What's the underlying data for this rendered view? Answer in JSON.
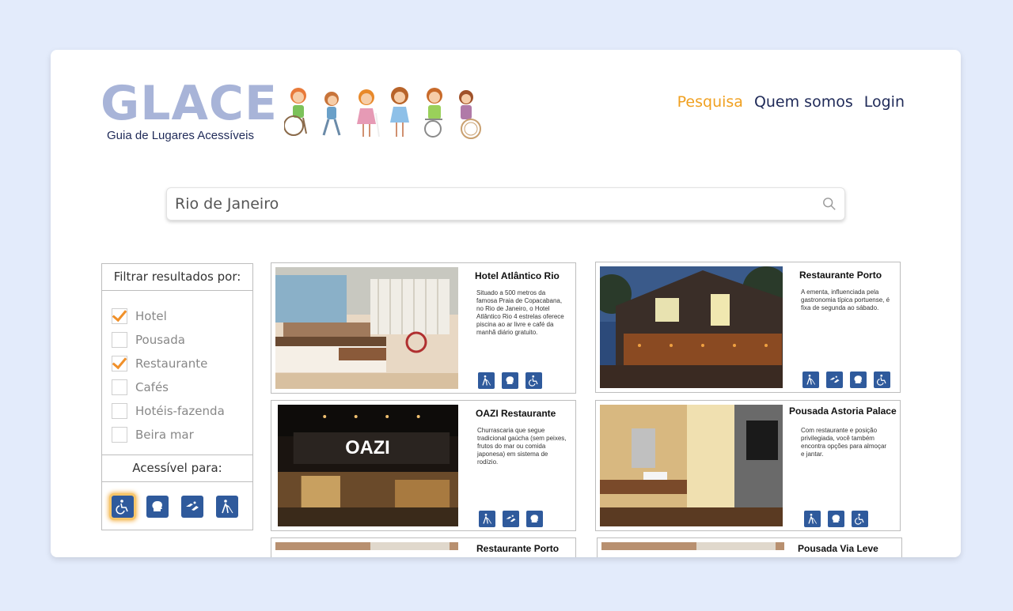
{
  "brand": {
    "title": "GLACE",
    "subtitle": "Guia de Lugares Acessíveis"
  },
  "nav": {
    "items": [
      "Pesquisa",
      "Quem somos",
      "Login"
    ],
    "active_color": "#f0a020",
    "color": "#1f2a58"
  },
  "search": {
    "value": "Rio de Janeiro",
    "icon": "search-icon"
  },
  "filter": {
    "title": "Filtrar resultados por:",
    "options": [
      {
        "label": "Hotel",
        "checked": true
      },
      {
        "label": "Pousada",
        "checked": false
      },
      {
        "label": "Restaurante",
        "checked": true
      },
      {
        "label": "Cafés",
        "checked": false
      },
      {
        "label": "Hotéis-fazenda",
        "checked": false
      },
      {
        "label": "Beira mar",
        "checked": false
      }
    ],
    "accessible_title": "Acessível para:",
    "accessible_icons": [
      "wheelchair-icon",
      "cognitive-icon",
      "sign-language-icon",
      "blind-icon"
    ],
    "selected_accessible": "wheelchair-icon"
  },
  "results": [
    {
      "name": "Hotel Atlântico Rio",
      "description": "Situado a 500 metros da famosa Praia de Copacabana, no Rio de Janeiro, o Hotel Atlântico Rio 4 estrelas oferece piscina ao ar livre e café da manhã diário gratuito.",
      "icons": [
        "blind-icon",
        "cognitive-icon",
        "wheelchair-icon"
      ]
    },
    {
      "name": "Restaurante Porto",
      "description": "A ementa, influenciada pela gastronomia típica portuense, é fixa de segunda ao sábado.",
      "icons": [
        "blind-icon",
        "sign-language-icon",
        "cognitive-icon",
        "wheelchair-icon"
      ]
    },
    {
      "name": "OAZI Restaurante",
      "description": "Churrascaria que segue tradicional gaúcha (sem peixes, frutos do mar ou comida japonesa) em sistema de rodízio.",
      "photo_text": "OAZI",
      "icons": [
        "blind-icon",
        "sign-language-icon",
        "cognitive-icon"
      ]
    },
    {
      "name": "Pousada Astoria Palace",
      "description": "Com restaurante e posição privilegiada, você também encontra opções para almoçar e jantar.",
      "icons": [
        "blind-icon",
        "cognitive-icon",
        "wheelchair-icon"
      ]
    },
    {
      "name": "Restaurante Porto",
      "description": "",
      "icons": []
    },
    {
      "name": "Pousada Via Leve",
      "description": "",
      "icons": []
    }
  ],
  "colors": {
    "background": "#e3ebfb",
    "icon_blue": "#2f5a9c",
    "logo": "#a8b4d8",
    "checkmark": "#f0902a"
  }
}
